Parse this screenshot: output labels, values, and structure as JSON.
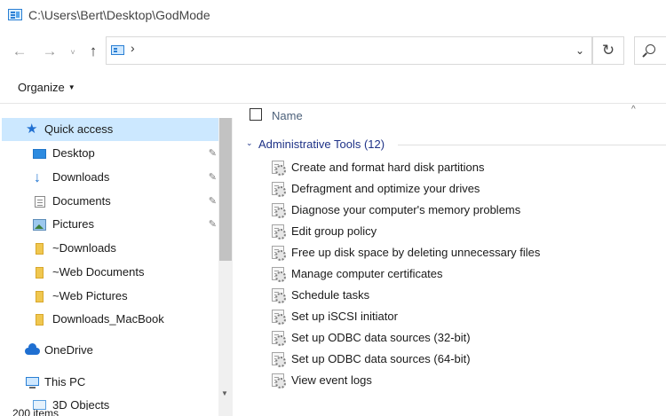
{
  "window": {
    "title": "C:\\Users\\Bert\\Desktop\\GodMode"
  },
  "toolbar": {
    "back_icon": "←",
    "forward_icon": "→",
    "recent_icon": "˅",
    "up_icon": "↑",
    "address_separator": "›",
    "address_dropdown": "⌄",
    "refresh_icon": "↻"
  },
  "commandbar": {
    "organize_label": "Organize",
    "organize_caret": "▼"
  },
  "navigation": {
    "items": [
      {
        "label": "Quick access",
        "icon": "star-icon"
      },
      {
        "label": "Desktop",
        "icon": "desktop-icon",
        "pinned": true
      },
      {
        "label": "Downloads",
        "icon": "download-icon",
        "pinned": true
      },
      {
        "label": "Documents",
        "icon": "document-icon",
        "pinned": true
      },
      {
        "label": "Pictures",
        "icon": "pictures-icon",
        "pinned": true
      },
      {
        "label": "~Downloads",
        "icon": "folder-icon"
      },
      {
        "label": "~Web Documents",
        "icon": "folder-icon"
      },
      {
        "label": "~Web Pictures",
        "icon": "folder-icon"
      },
      {
        "label": "Downloads_MacBook",
        "icon": "folder-icon"
      },
      {
        "label": "OneDrive",
        "icon": "cloud-icon"
      },
      {
        "label": "This PC",
        "icon": "pc-icon"
      },
      {
        "label": "3D Objects",
        "icon": "3d-objects-icon"
      }
    ],
    "pin_glyph": "📌"
  },
  "status": {
    "items_count": "200 items"
  },
  "content": {
    "column_name": "Name",
    "sort_indicator": "^",
    "group": {
      "label": "Administrative Tools (12)",
      "collapse_glyph": "⌄"
    },
    "items": [
      "Create and format hard disk partitions",
      "Defragment and optimize your drives",
      "Diagnose your computer's memory problems",
      "Edit group policy",
      "Free up disk space by deleting unnecessary files",
      "Manage computer certificates",
      "Schedule tasks",
      "Set up iSCSI initiator",
      "Set up ODBC data sources (32-bit)",
      "Set up ODBC data sources (64-bit)",
      "View event logs"
    ]
  },
  "colors": {
    "accent": "#1f6fd1",
    "selection": "#cce8ff",
    "group_text": "#1e3287"
  }
}
